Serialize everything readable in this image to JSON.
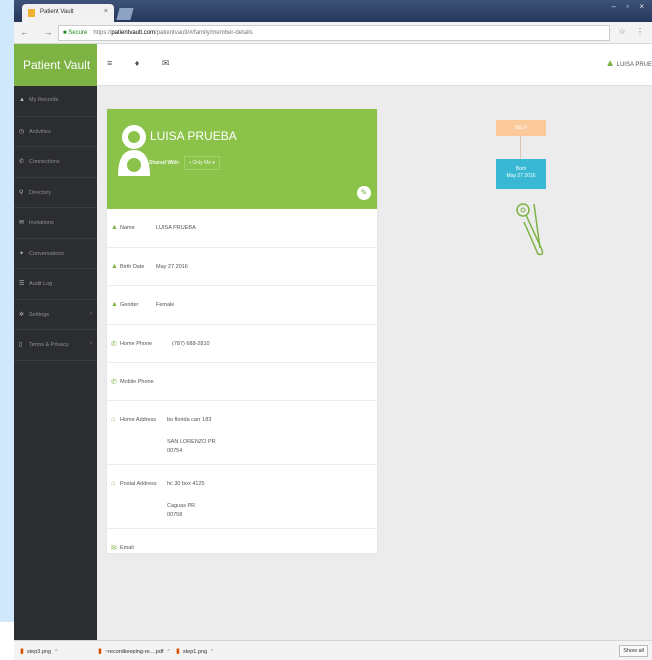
{
  "browser": {
    "tab_title": "Patient Vault",
    "tab_close": "×",
    "nav_buttons": "← → C",
    "secure_label": "Secure",
    "url_scheme": "https://",
    "url_host": "patientvault.com",
    "url_path": "/patientvault/#/family/member-details",
    "right_icons": "☆ ⋮",
    "window_controls": "– ▫ ×"
  },
  "app": {
    "brand": "Patient Vault",
    "topbar_icons": "≡ ♦ ✉",
    "user_name": "LUISA PRUE",
    "sidebar": [
      {
        "label": "My Records",
        "icon": "person-icon",
        "glyph": "▲"
      },
      {
        "label": "Activities",
        "icon": "clock-icon",
        "glyph": "◷"
      },
      {
        "label": "Connections",
        "icon": "phone-icon",
        "glyph": "✆"
      },
      {
        "label": "Directory",
        "icon": "search-icon",
        "glyph": "⚲"
      },
      {
        "label": "Invitations",
        "icon": "envelope-icon",
        "glyph": "✉"
      },
      {
        "label": "Conversations",
        "icon": "chat-icon",
        "glyph": "✦"
      },
      {
        "label": "Audit Log",
        "icon": "list-icon",
        "glyph": "☰"
      },
      {
        "label": "Settings",
        "icon": "gear-icon",
        "glyph": "✲",
        "chevron": "›"
      },
      {
        "label": "Terms & Privacy",
        "icon": "document-icon",
        "glyph": "▯",
        "chevron": "›"
      }
    ]
  },
  "profile": {
    "name": "LUISA PRUEBA",
    "shared_with_label": "Shared With:",
    "shared_with_value": "Only Me ▾",
    "fields": {
      "name_label": "Name",
      "name_value": "LUISA PRUEBA",
      "birth_label": "Birth Date",
      "birth_value": "May 27 2016",
      "gender_label": "Gender",
      "gender_value": "Female",
      "home_phone_label": "Home Phone",
      "home_phone_value": "(787) 688-2810",
      "mobile_label": "Mobile Phone",
      "mobile_value": "",
      "home_address_label": "Home Address",
      "home_address_line1": "bo florida carr 183",
      "home_address_line2": "SAN LORENZO PR",
      "home_address_line3": "00754",
      "postal_address_label": "Postal Address",
      "postal_address_line1": "hc 30 box 4125",
      "postal_address_line2": "Caguas PR",
      "postal_address_line3": "00758",
      "email_label": "Email",
      "email_value": ""
    }
  },
  "tree": {
    "top_box": "SELF",
    "born_label": "Born",
    "born_date": "May 27 2016"
  },
  "downloads": {
    "items": [
      "step3.png",
      "~recordkeeping-re....pdf",
      "step1.png"
    ],
    "show_all": "Show all"
  },
  "colors": {
    "brand_green": "#7cb342",
    "header_green": "#8bc34a",
    "sidebar_dark": "#2c2d30",
    "tree_orange": "#fbc89a",
    "tree_blue": "#38b8d5"
  }
}
